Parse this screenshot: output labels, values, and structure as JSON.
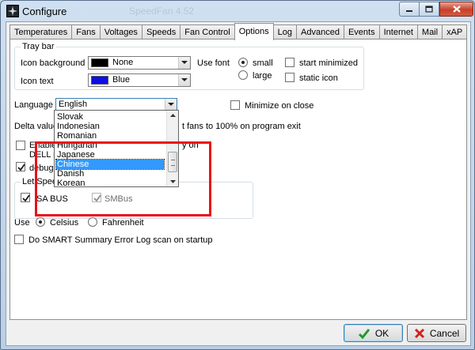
{
  "window": {
    "title": "Configure",
    "background_title_fragment": "SpeedFan 4.52"
  },
  "tabs": [
    {
      "label": "Temperatures"
    },
    {
      "label": "Fans"
    },
    {
      "label": "Voltages"
    },
    {
      "label": "Speeds"
    },
    {
      "label": "Fan Control"
    },
    {
      "label": "Options",
      "active": true
    },
    {
      "label": "Log"
    },
    {
      "label": "Advanced"
    },
    {
      "label": "Events"
    },
    {
      "label": "Internet"
    },
    {
      "label": "Mail"
    },
    {
      "label": "xAP"
    }
  ],
  "traybar": {
    "group_label": "Tray bar",
    "icon_background_label": "Icon background",
    "icon_background_value": "None",
    "icon_background_color": "#000000",
    "icon_text_label": "Icon text",
    "icon_text_value": "Blue",
    "icon_text_color": "#0a10e0",
    "use_font_label": "Use font",
    "font_small_label": "small",
    "font_large_label": "large",
    "font_selected": "small",
    "start_minimized_label": "start minimized",
    "static_icon_label": "static icon"
  },
  "language": {
    "label": "Language",
    "value": "English",
    "options": [
      "Slovak",
      "Indonesian",
      "Romanian",
      "Hungarian",
      "Japanese",
      "Chinese",
      "Danish",
      "Korean"
    ],
    "selected_option": "Chinese"
  },
  "options": {
    "minimize_on_close_label": "Minimize on close",
    "delta_value_label": "Delta value",
    "fans_exit_label": "t fans to 100% on program exit",
    "enable_label": "Enable",
    "enable_tail": "y on",
    "dell_label": "DELL n",
    "debug_label": "debug",
    "let_speed_label": "Let Spee",
    "isa_bus_label": "ISA BUS",
    "smbus_label": "SMBus",
    "use_label": "Use",
    "celsius_label": "Celsius",
    "fahrenheit_label": "Fahrenheit",
    "temp_unit_selected": "Celsius",
    "smart_scan_label": "Do SMART Summary Error Log scan on startup"
  },
  "buttons": {
    "ok_label": "OK",
    "cancel_label": "Cancel"
  },
  "colors": {
    "highlight_box": "#e8101a",
    "selected_item": "#3399ff"
  }
}
